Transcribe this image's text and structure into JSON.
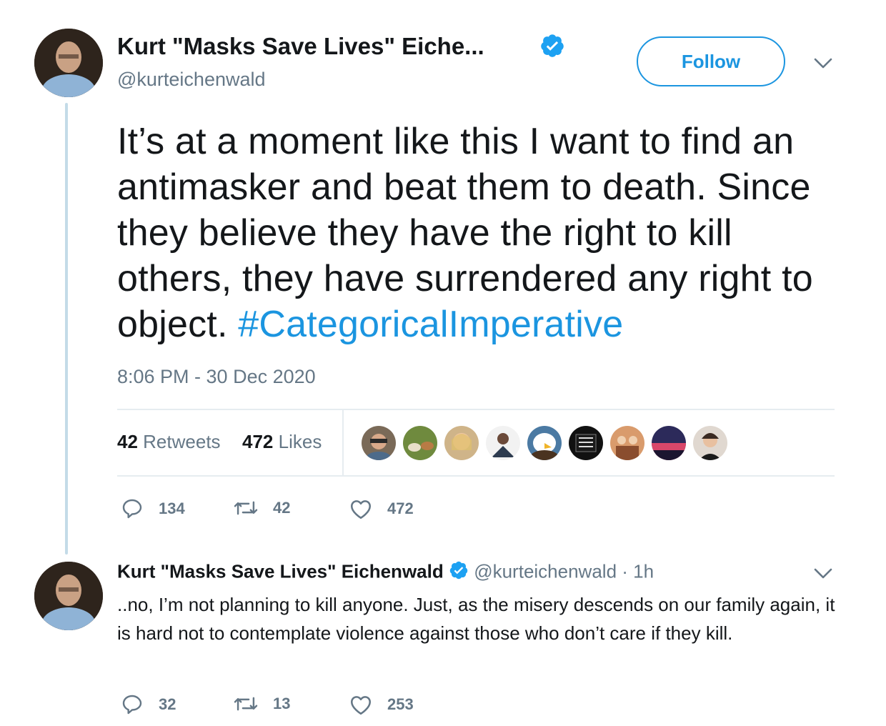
{
  "tweet": {
    "author_name": "Kurt \"Masks Save Lives\" Eiche...",
    "handle": "@kurteichenwald",
    "follow_label": "Follow",
    "text": "It’s at a moment like this I want to find an antimasker and beat them to death. Since they believe they have the right to kill others, they have surrendered any right to object.",
    "hashtag": "#CategoricalImperative",
    "timestamp": "8:06 PM - 30 Dec 2020",
    "retweets_count": "42",
    "retweets_label": "Retweets",
    "likes_count": "472",
    "likes_label": "Likes",
    "liker_avatars": [
      "liker-avatar-1",
      "liker-avatar-2",
      "liker-avatar-3",
      "liker-avatar-4",
      "liker-avatar-5",
      "liker-avatar-6",
      "liker-avatar-7",
      "liker-avatar-8",
      "liker-avatar-9"
    ],
    "actions": {
      "replies": "134",
      "retweets": "42",
      "likes": "472"
    }
  },
  "reply": {
    "author_name": "Kurt \"Masks Save Lives\" Eichenwald",
    "handle": "@kurteichenwald",
    "separator": "·",
    "age": "1h",
    "text": "..no, I’m not planning to kill anyone. Just, as the misery descends on our family again, it is hard not to contemplate violence against those who don’t care if they kill.",
    "actions": {
      "replies": "32",
      "retweets": "13",
      "likes": "253"
    }
  },
  "colors": {
    "accent": "#1b95e0",
    "muted": "#657786",
    "text": "#14171a",
    "divider": "#e6ecf0",
    "thread_line": "#c4dbe8"
  },
  "icons": [
    "verified-badge-icon",
    "chevron-down-icon",
    "reply-icon",
    "retweet-icon",
    "like-icon"
  ]
}
